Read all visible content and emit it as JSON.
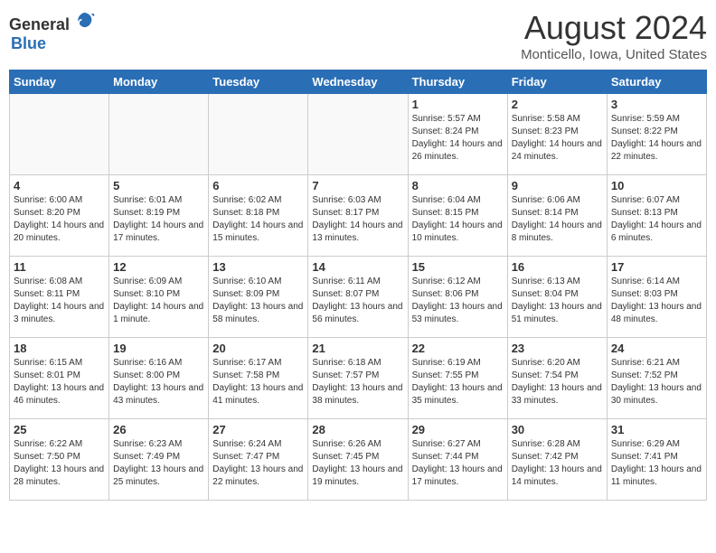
{
  "header": {
    "logo_general": "General",
    "logo_blue": "Blue",
    "title": "August 2024",
    "subtitle": "Monticello, Iowa, United States"
  },
  "days_of_week": [
    "Sunday",
    "Monday",
    "Tuesday",
    "Wednesday",
    "Thursday",
    "Friday",
    "Saturday"
  ],
  "weeks": [
    [
      {
        "day": "",
        "info": ""
      },
      {
        "day": "",
        "info": ""
      },
      {
        "day": "",
        "info": ""
      },
      {
        "day": "",
        "info": ""
      },
      {
        "day": "1",
        "info": "Sunrise: 5:57 AM\nSunset: 8:24 PM\nDaylight: 14 hours and 26 minutes."
      },
      {
        "day": "2",
        "info": "Sunrise: 5:58 AM\nSunset: 8:23 PM\nDaylight: 14 hours and 24 minutes."
      },
      {
        "day": "3",
        "info": "Sunrise: 5:59 AM\nSunset: 8:22 PM\nDaylight: 14 hours and 22 minutes."
      }
    ],
    [
      {
        "day": "4",
        "info": "Sunrise: 6:00 AM\nSunset: 8:20 PM\nDaylight: 14 hours and 20 minutes."
      },
      {
        "day": "5",
        "info": "Sunrise: 6:01 AM\nSunset: 8:19 PM\nDaylight: 14 hours and 17 minutes."
      },
      {
        "day": "6",
        "info": "Sunrise: 6:02 AM\nSunset: 8:18 PM\nDaylight: 14 hours and 15 minutes."
      },
      {
        "day": "7",
        "info": "Sunrise: 6:03 AM\nSunset: 8:17 PM\nDaylight: 14 hours and 13 minutes."
      },
      {
        "day": "8",
        "info": "Sunrise: 6:04 AM\nSunset: 8:15 PM\nDaylight: 14 hours and 10 minutes."
      },
      {
        "day": "9",
        "info": "Sunrise: 6:06 AM\nSunset: 8:14 PM\nDaylight: 14 hours and 8 minutes."
      },
      {
        "day": "10",
        "info": "Sunrise: 6:07 AM\nSunset: 8:13 PM\nDaylight: 14 hours and 6 minutes."
      }
    ],
    [
      {
        "day": "11",
        "info": "Sunrise: 6:08 AM\nSunset: 8:11 PM\nDaylight: 14 hours and 3 minutes."
      },
      {
        "day": "12",
        "info": "Sunrise: 6:09 AM\nSunset: 8:10 PM\nDaylight: 14 hours and 1 minute."
      },
      {
        "day": "13",
        "info": "Sunrise: 6:10 AM\nSunset: 8:09 PM\nDaylight: 13 hours and 58 minutes."
      },
      {
        "day": "14",
        "info": "Sunrise: 6:11 AM\nSunset: 8:07 PM\nDaylight: 13 hours and 56 minutes."
      },
      {
        "day": "15",
        "info": "Sunrise: 6:12 AM\nSunset: 8:06 PM\nDaylight: 13 hours and 53 minutes."
      },
      {
        "day": "16",
        "info": "Sunrise: 6:13 AM\nSunset: 8:04 PM\nDaylight: 13 hours and 51 minutes."
      },
      {
        "day": "17",
        "info": "Sunrise: 6:14 AM\nSunset: 8:03 PM\nDaylight: 13 hours and 48 minutes."
      }
    ],
    [
      {
        "day": "18",
        "info": "Sunrise: 6:15 AM\nSunset: 8:01 PM\nDaylight: 13 hours and 46 minutes."
      },
      {
        "day": "19",
        "info": "Sunrise: 6:16 AM\nSunset: 8:00 PM\nDaylight: 13 hours and 43 minutes."
      },
      {
        "day": "20",
        "info": "Sunrise: 6:17 AM\nSunset: 7:58 PM\nDaylight: 13 hours and 41 minutes."
      },
      {
        "day": "21",
        "info": "Sunrise: 6:18 AM\nSunset: 7:57 PM\nDaylight: 13 hours and 38 minutes."
      },
      {
        "day": "22",
        "info": "Sunrise: 6:19 AM\nSunset: 7:55 PM\nDaylight: 13 hours and 35 minutes."
      },
      {
        "day": "23",
        "info": "Sunrise: 6:20 AM\nSunset: 7:54 PM\nDaylight: 13 hours and 33 minutes."
      },
      {
        "day": "24",
        "info": "Sunrise: 6:21 AM\nSunset: 7:52 PM\nDaylight: 13 hours and 30 minutes."
      }
    ],
    [
      {
        "day": "25",
        "info": "Sunrise: 6:22 AM\nSunset: 7:50 PM\nDaylight: 13 hours and 28 minutes."
      },
      {
        "day": "26",
        "info": "Sunrise: 6:23 AM\nSunset: 7:49 PM\nDaylight: 13 hours and 25 minutes."
      },
      {
        "day": "27",
        "info": "Sunrise: 6:24 AM\nSunset: 7:47 PM\nDaylight: 13 hours and 22 minutes."
      },
      {
        "day": "28",
        "info": "Sunrise: 6:26 AM\nSunset: 7:45 PM\nDaylight: 13 hours and 19 minutes."
      },
      {
        "day": "29",
        "info": "Sunrise: 6:27 AM\nSunset: 7:44 PM\nDaylight: 13 hours and 17 minutes."
      },
      {
        "day": "30",
        "info": "Sunrise: 6:28 AM\nSunset: 7:42 PM\nDaylight: 13 hours and 14 minutes."
      },
      {
        "day": "31",
        "info": "Sunrise: 6:29 AM\nSunset: 7:41 PM\nDaylight: 13 hours and 11 minutes."
      }
    ]
  ]
}
